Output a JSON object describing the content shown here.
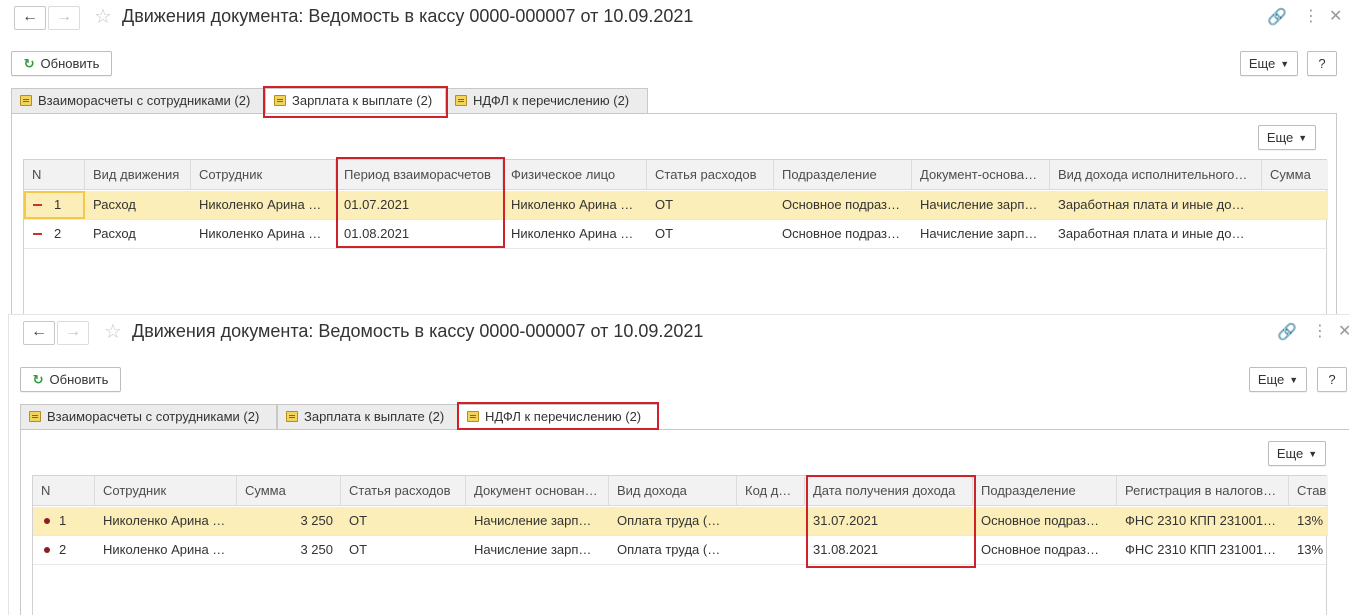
{
  "window1": {
    "title": "Движения документа: Ведомость в кассу 0000-000007 от 10.09.2021",
    "refresh_label": "Обновить",
    "more_label": "Еще",
    "help_label": "?",
    "tabs": [
      {
        "label": "Взаиморасчеты с сотрудниками (2)"
      },
      {
        "label": "Зарплата к выплате (2)"
      },
      {
        "label": "НДФЛ к перечислению (2)"
      }
    ],
    "active_tab": 1,
    "grid_more_label": "Еще",
    "columns": [
      "N",
      "Вид движения",
      "Сотрудник",
      "Период взаиморасчетов",
      "Физическое лицо",
      "Статья расходов",
      "Подразделение",
      "Документ-основа…",
      "Вид дохода исполнительного…",
      "Сумма"
    ],
    "rows": [
      {
        "n": "1",
        "kind": "Расход",
        "employee": "Николенко Арина …",
        "period": "01.07.2021",
        "person": "Николенко Арина …",
        "article": "ОТ",
        "dept": "Основное подраз…",
        "doc": "Начисление зарп…",
        "income": "Заработная плата и иные до…",
        "sum": ""
      },
      {
        "n": "2",
        "kind": "Расход",
        "employee": "Николенко Арина …",
        "period": "01.08.2021",
        "person": "Николенко Арина …",
        "article": "ОТ",
        "dept": "Основное подраз…",
        "doc": "Начисление зарп…",
        "income": "Заработная плата и иные до…",
        "sum": ""
      }
    ]
  },
  "window2": {
    "title": "Движения документа: Ведомость в кассу 0000-000007 от 10.09.2021",
    "refresh_label": "Обновить",
    "more_label": "Еще",
    "help_label": "?",
    "tabs": [
      {
        "label": "Взаиморасчеты с сотрудниками (2)"
      },
      {
        "label": "Зарплата к выплате (2)"
      },
      {
        "label": "НДФЛ к перечислению (2)"
      }
    ],
    "active_tab": 2,
    "grid_more_label": "Еще",
    "columns": [
      "N",
      "Сотрудник",
      "Сумма",
      "Статья расходов",
      "Документ основан…",
      "Вид дохода",
      "Код д…",
      "Дата получения дохода",
      "Подразделение",
      "Регистрация в налогов…",
      "Став"
    ],
    "rows": [
      {
        "n": "1",
        "employee": "Николенко Арина …",
        "sum": "3 250",
        "article": "ОТ",
        "doc": "Начисление зарп…",
        "income": "Оплата труда (…",
        "code": "",
        "date": "31.07.2021",
        "dept": "Основное подраз…",
        "reg": "ФНС 2310 КПП 231001…",
        "rate": "13%"
      },
      {
        "n": "2",
        "employee": "Николенко Арина …",
        "sum": "3 250",
        "article": "ОТ",
        "doc": "Начисление зарп…",
        "income": "Оплата труда (…",
        "code": "",
        "date": "31.08.2021",
        "dept": "Основное подраз…",
        "reg": "ФНС 2310 КПП 231001…",
        "rate": "13%"
      }
    ]
  },
  "colors": {
    "selected_row": "#fbeeb8",
    "highlight_box": "#d0202a",
    "refresh_icon": "#2e9b3b"
  },
  "icons": {
    "back": "arrow-left-icon",
    "forward": "arrow-right-icon",
    "favorite": "star-icon",
    "link": "link-icon",
    "menu": "kebab-icon",
    "close": "close-icon",
    "refresh": "refresh-icon",
    "tab": "register-icon"
  }
}
